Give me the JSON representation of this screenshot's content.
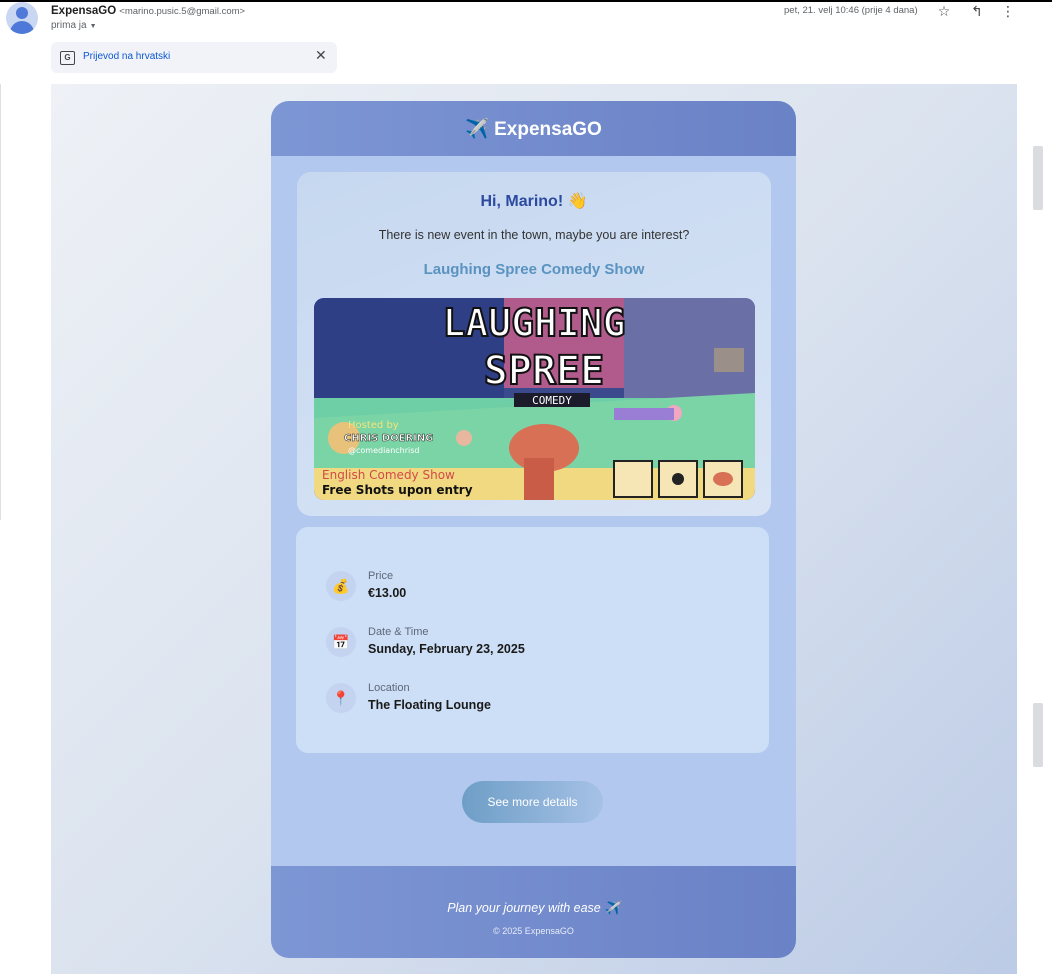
{
  "header": {
    "sender_name": "ExpensaGO",
    "sender_email": "<marino.pusic.5@gmail.com>",
    "recipient": "prima ja",
    "datetime": "pet, 21. velj 10:46 (prije 4 dana)",
    "icons": [
      "star-icon",
      "reply-icon",
      "more-vert-icon"
    ]
  },
  "translate_bar": {
    "label": "Prijevod na hrvatski",
    "icon": "translate-icon",
    "close_icon": "close-icon"
  },
  "email": {
    "brand_title": "✈️ ExpensaGO",
    "greeting": "Hi, Marino! 👋",
    "intro": "There is new event in the town, maybe you are interest?",
    "event_name": "Laughing Spree Comedy Show",
    "poster": {
      "title_line1": "LAUGHING",
      "title_line2": "SPREE",
      "subtitle": "COMEDY",
      "host_line1": "Hosted by",
      "host_line2": "CHRIS DOERING",
      "host_handle": "@comedianchrisd",
      "bottom_line1": "English Comedy Show",
      "bottom_line2": "Free Shots upon entry"
    },
    "details": [
      {
        "icon": "money-bag-icon",
        "glyph": "💰",
        "label": "Price",
        "value": "€13.00"
      },
      {
        "icon": "calendar-icon",
        "glyph": "📅",
        "label": "Date & Time",
        "value": "Sunday, February 23, 2025"
      },
      {
        "icon": "location-pin-icon",
        "glyph": "📍",
        "label": "Location",
        "value": "The Floating Lounge"
      }
    ],
    "cta_label": "See more details",
    "footer_tagline": "Plan your journey with ease ✈️",
    "footer_copyright": "© 2025 ExpensaGO"
  },
  "colors": {
    "brand_gradient_start": "#7d96d4",
    "brand_gradient_end": "#6a82c6",
    "greeting": "#2b4aa0",
    "event_name": "#5a93c0",
    "card_bg": "#b2c8ee"
  }
}
